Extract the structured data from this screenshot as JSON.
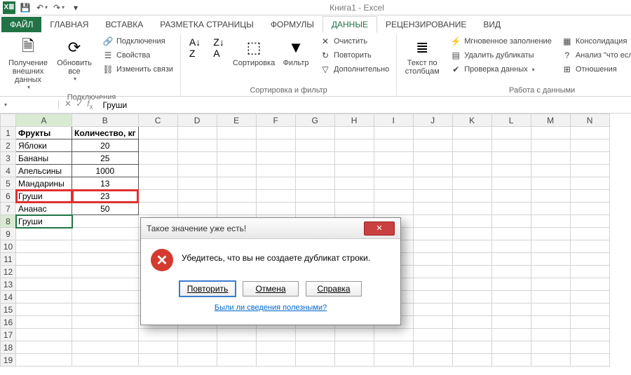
{
  "title": "Книга1 - Excel",
  "qat": {
    "save": "💾",
    "undo": "↶",
    "redo": "↷"
  },
  "tabs": {
    "file": "ФАЙЛ",
    "items": [
      "ГЛАВНАЯ",
      "ВСТАВКА",
      "РАЗМЕТКА СТРАНИЦЫ",
      "ФОРМУЛЫ",
      "ДАННЫЕ",
      "РЕЦЕНЗИРОВАНИЕ",
      "ВИД"
    ],
    "active_index": 4
  },
  "ribbon": {
    "group1": {
      "getdata": "Получение\nвнешних данных",
      "refresh": "Обновить\nвсе",
      "connections": "Подключения",
      "properties": "Свойства",
      "editlinks": "Изменить связи",
      "label": "Подключения"
    },
    "group2": {
      "sort": "Сортировка",
      "filter": "Фильтр",
      "clear": "Очистить",
      "reapply": "Повторить",
      "advanced": "Дополнительно",
      "label": "Сортировка и фильтр"
    },
    "group3": {
      "texttocols": "Текст по\nстолбцам",
      "flashfill": "Мгновенное заполнение",
      "removedup": "Удалить дубликаты",
      "validation": "Проверка данных",
      "consolidate": "Консолидация",
      "whatif": "Анализ \"что если\"",
      "relations": "Отношения",
      "label": "Работа с данными"
    }
  },
  "namebox": "",
  "formula": "Груши",
  "columns": [
    "A",
    "B",
    "C",
    "D",
    "E",
    "F",
    "G",
    "H",
    "I",
    "J",
    "K",
    "L",
    "M",
    "N"
  ],
  "rows": 19,
  "cells": {
    "headerA": "Фрукты",
    "headerB": "Количество, кг",
    "data": [
      {
        "a": "Яблоки",
        "b": "20"
      },
      {
        "a": "Бананы",
        "b": "25"
      },
      {
        "a": "Апельсины",
        "b": "1000"
      },
      {
        "a": "Мандарины",
        "b": "13"
      },
      {
        "a": "Груши",
        "b": "23"
      },
      {
        "a": "Ананас",
        "b": "50"
      },
      {
        "a": "Груши",
        "b": ""
      }
    ]
  },
  "dialog": {
    "title": "Такое значение уже есть!",
    "message": "Убедитесь, что вы не создаете дубликат строки.",
    "retry": "Повторить",
    "cancel": "Отмена",
    "help": "Справка",
    "feedback": "Были ли сведения полезными?"
  }
}
